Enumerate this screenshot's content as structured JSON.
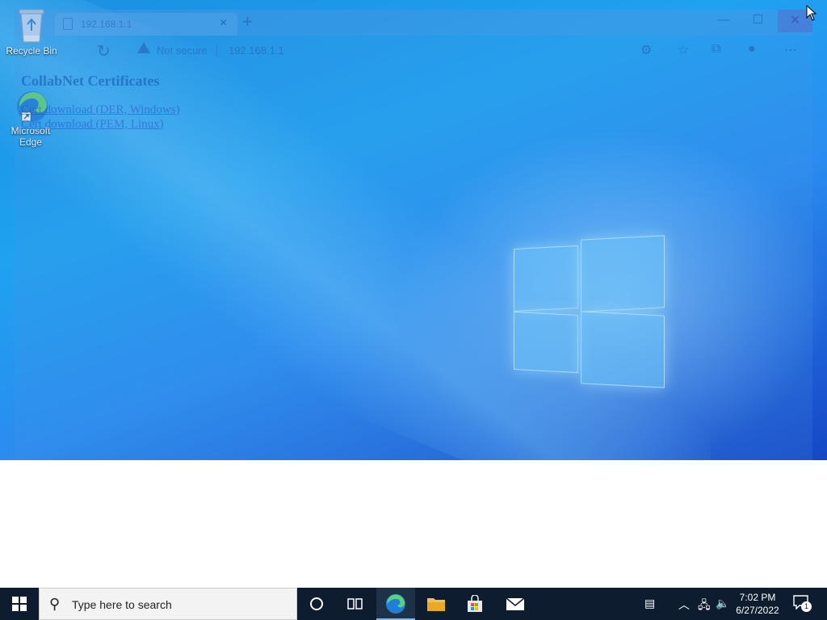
{
  "desktop": {
    "icons": [
      {
        "label": "Recycle Bin",
        "icon": "recycle-bin-icon"
      },
      {
        "label": "Microsoft Edge",
        "icon": "edge-icon"
      }
    ]
  },
  "browser": {
    "tab_title": "192.168.1.1",
    "tab_close": "×",
    "new_tab": "+",
    "security_text": "Not secure",
    "url": "192.168.1.1",
    "page": {
      "title": "CollabNet Certificates",
      "links": [
        "Cert download (DER, Windows)",
        "Cert download (PEM, Linux)"
      ]
    }
  },
  "taskbar": {
    "search_placeholder": "Type here to search",
    "apps": [
      "task-view",
      "edge",
      "file-explorer",
      "microsoft-store",
      "mail"
    ],
    "clock_time": "7:02 PM",
    "clock_date": "6/27/2022",
    "notification_count": "1"
  }
}
